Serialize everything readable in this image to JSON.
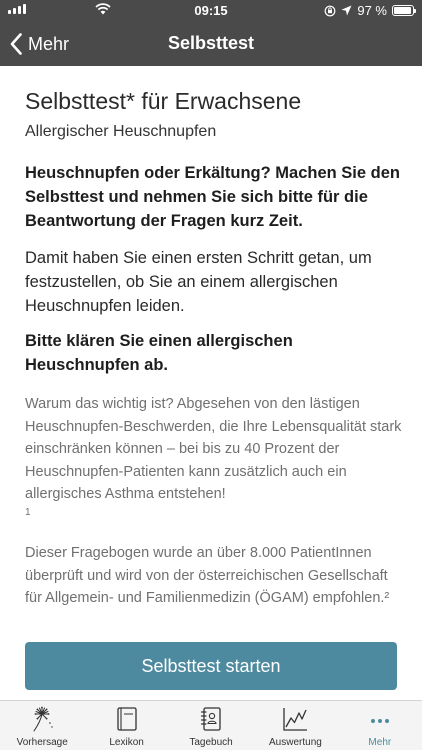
{
  "status_bar": {
    "time": "09:15",
    "battery_text": "97 %",
    "battery_level_percent": 97,
    "icons": [
      "signal-icon",
      "wifi-icon",
      "orientation-lock-icon",
      "location-icon",
      "battery-icon"
    ]
  },
  "nav": {
    "back_label": "Mehr",
    "title": "Selbsttest"
  },
  "content": {
    "heading": "Selbsttest* für Erwachsene",
    "subheading": "Allergischer Heuschnupfen",
    "lead": "Heuschnupfen oder Erkältung? Machen Sie den Selbsttest und nehmen Sie sich bitte für die Beantwortung der Fragen kurz Zeit.",
    "paragraph": "Damit haben Sie einen ersten Schritt getan, um festzustellen, ob Sie an einem allergischen Heuschnupfen leiden.",
    "lead2": "Bitte klären Sie einen allergischen Heuschnupfen ab.",
    "why_text": "Warum das wichtig ist? Abgesehen von den lästigen Heuschnupfen-Beschwerden, die Ihre Lebensqualität stark einschränken können – bei bis zu 40 Prozent der Heuschnupfen-Patienten kann zusätzlich auch ein allergisches Asthma entstehen!",
    "why_footnote": "1",
    "questionnaire_text": "Dieser Fragebogen wurde an über 8.000 PatientInnen überprüft und wird von der österreichischen Gesellschaft für Allgemein- und Familienmedizin (ÖGAM) empfohlen.²"
  },
  "start_button_label": "Selbsttest starten",
  "tabbar": {
    "items": [
      {
        "label": "Vorhersage",
        "icon": "dandelion-icon"
      },
      {
        "label": "Lexikon",
        "icon": "book-icon"
      },
      {
        "label": "Tagebuch",
        "icon": "diary-icon"
      },
      {
        "label": "Auswertung",
        "icon": "chart-icon"
      },
      {
        "label": "Mehr",
        "icon": "more-icon"
      }
    ],
    "active_index": 4
  },
  "colors": {
    "header_bg": "#4a4a4a",
    "accent": "#4e8a9f",
    "tabbar_bg": "#f4f4f4"
  }
}
